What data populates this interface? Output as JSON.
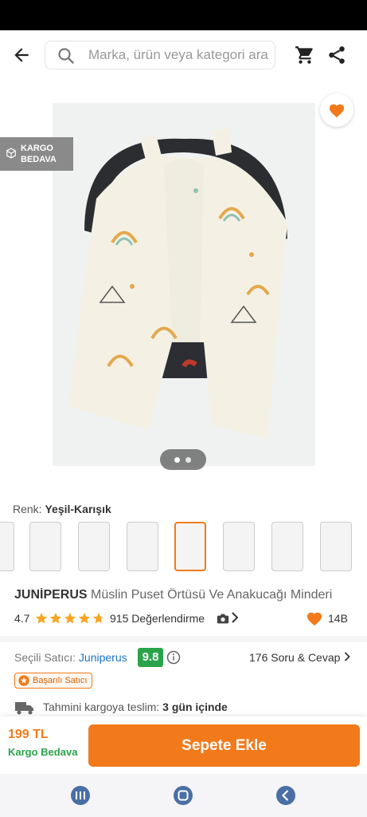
{
  "search": {
    "placeholder": "Marka, ürün veya kategori ara"
  },
  "gallery": {
    "cargo_badge_line1": "KARGO",
    "cargo_badge_line2": "BEDAVA",
    "image_count": 2,
    "active_image": 1
  },
  "variant": {
    "label": "Renk:",
    "value": "Yeşil-Karışık",
    "thumbnail_count": 8,
    "selected_index": 4
  },
  "product": {
    "brand": "JUNİPERUS",
    "name": "Müslin Puset Örtüsü Ve Anakucağı Minderi",
    "rating": "4.7",
    "rating_value": 4.7,
    "review_count": "915 Değerlendirme",
    "likes": "14B"
  },
  "seller": {
    "label": "Seçili Satıcı:",
    "name": "Juniperus",
    "score": "9.8",
    "qa": "176 Soru & Cevap",
    "badge": "Başarılı Satıcı"
  },
  "delivery": {
    "label": "Tahmini kargoya teslim:",
    "value": "3 gün içinde"
  },
  "bottom": {
    "price": "199 TL",
    "shipping": "Kargo Bedava",
    "add_to_cart": "Sepete Ekle"
  },
  "colors": {
    "accent": "#f27a1a",
    "green": "#2aa34a",
    "seller_blue": "#1a73c8"
  }
}
